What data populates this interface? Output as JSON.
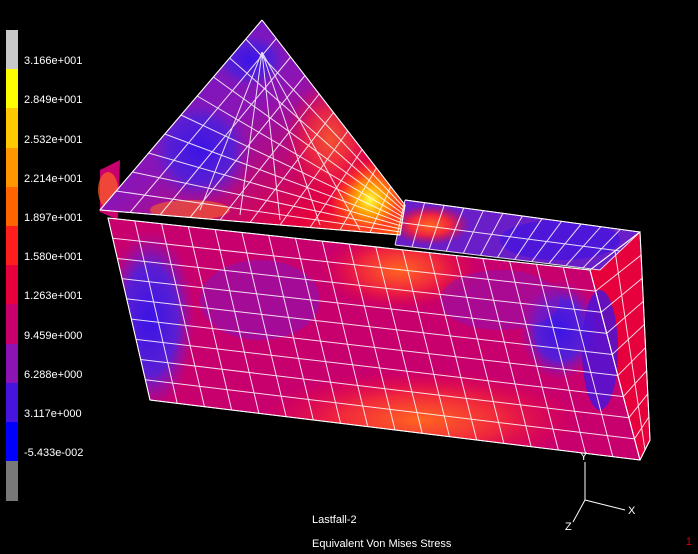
{
  "legend": {
    "labels": [
      "3.166e+001",
      "2.849e+001",
      "2.532e+001",
      "2.214e+001",
      "1.897e+001",
      "1.580e+001",
      "1.263e+001",
      "9.459e+000",
      "6.288e+000",
      "3.117e+000",
      "-5.433e-002"
    ],
    "colors": [
      "#c8c8c8",
      "#ffff00",
      "#ffc800",
      "#ff9600",
      "#ff6400",
      "#ff1e1e",
      "#e6003c",
      "#c8006e",
      "#8c14b4",
      "#4614dc",
      "#0000ff",
      "#787878"
    ]
  },
  "caption": {
    "load_case": "Lastfall-2",
    "result_type": "Equivalent Von Mises Stress"
  },
  "axes": {
    "x": "X",
    "y": "Y",
    "z": "Z"
  },
  "corner_mark": "1",
  "colors": {
    "background": "#000000",
    "mesh_lines": "#ffffff",
    "base_fill": "#c8006e",
    "low_stress": "#3c14dc",
    "high_stress": "#ffff40"
  }
}
